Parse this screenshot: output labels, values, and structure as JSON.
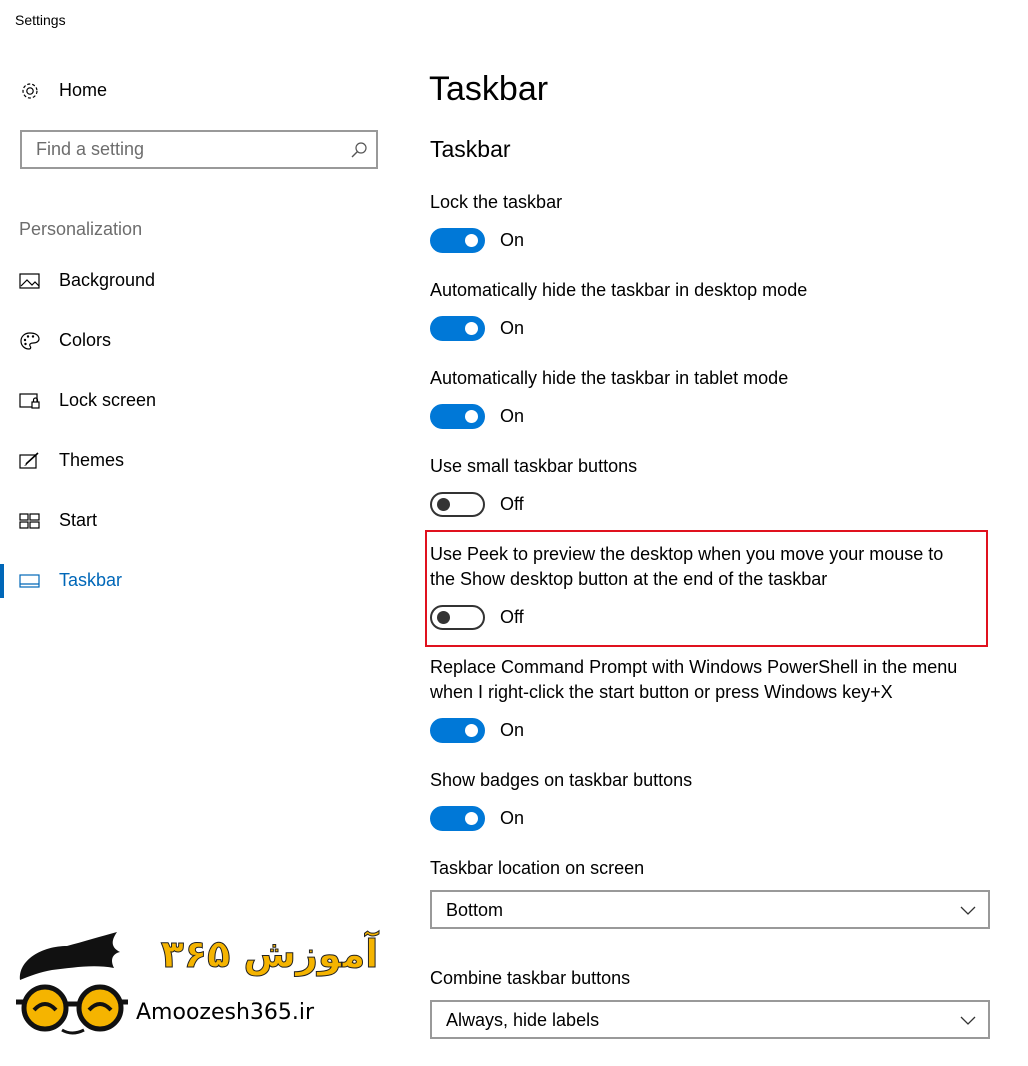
{
  "window": {
    "title": "Settings"
  },
  "sidebar": {
    "home_label": "Home",
    "search_placeholder": "Find a setting",
    "section_label": "Personalization",
    "items": [
      {
        "label": "Background",
        "icon": "picture-icon"
      },
      {
        "label": "Colors",
        "icon": "palette-icon"
      },
      {
        "label": "Lock screen",
        "icon": "lock-screen-icon"
      },
      {
        "label": "Themes",
        "icon": "themes-icon"
      },
      {
        "label": "Start",
        "icon": "start-icon"
      },
      {
        "label": "Taskbar",
        "icon": "taskbar-icon",
        "active": true
      }
    ]
  },
  "main": {
    "page_title": "Taskbar",
    "section_title": "Taskbar",
    "settings": [
      {
        "label": "Lock the taskbar",
        "state": "On"
      },
      {
        "label": "Automatically hide the taskbar in desktop mode",
        "state": "On"
      },
      {
        "label": "Automatically hide the taskbar in tablet mode",
        "state": "On"
      },
      {
        "label": "Use small taskbar buttons",
        "state": "Off"
      },
      {
        "label_line1": "Use Peek to preview the desktop when you move your mouse to",
        "label_line2": "the Show desktop button at the end of the taskbar",
        "state": "Off"
      },
      {
        "label_line1": "Replace Command Prompt with Windows PowerShell in the menu",
        "label_line2": "when I right-click the start button or press Windows key+X",
        "state": "On"
      },
      {
        "label": "Show badges on taskbar buttons",
        "state": "On"
      }
    ],
    "location": {
      "label": "Taskbar location on screen",
      "value": "Bottom"
    },
    "combine": {
      "label": "Combine taskbar buttons",
      "value": "Always, hide labels"
    }
  },
  "watermark": {
    "text": "Amoozesh365.ir",
    "persian_text": "آموزش ۳۶۵"
  },
  "colors": {
    "accent": "#0078d7",
    "highlight": "#e0111e",
    "logo_yellow": "#f5b400"
  }
}
